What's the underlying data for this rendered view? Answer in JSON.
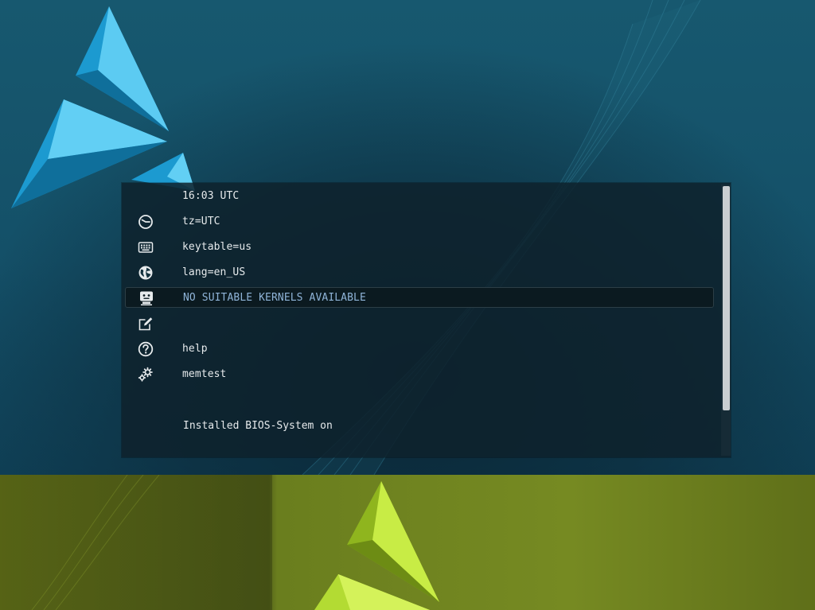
{
  "menu": {
    "items": [
      {
        "icon": "none",
        "label": "16:03 UTC",
        "selected": false
      },
      {
        "icon": "clock-icon",
        "label": "tz=UTC",
        "selected": false
      },
      {
        "icon": "keyboard-icon",
        "label": "keytable=us",
        "selected": false
      },
      {
        "icon": "globe-icon",
        "label": "lang=en_US",
        "selected": false
      },
      {
        "icon": "monitor-face-icon",
        "label": "NO SUITABLE KERNELS AVAILABLE",
        "selected": true
      },
      {
        "icon": "edit-icon",
        "label": "",
        "selected": false
      },
      {
        "icon": "help-icon",
        "label": "help",
        "selected": false
      },
      {
        "icon": "gears-icon",
        "label": "memtest",
        "selected": false
      }
    ],
    "footer": "Installed BIOS-System on"
  },
  "colors": {
    "background_top": "#145068",
    "background_bottom": "#768a22",
    "panel": "#0e222c",
    "text": "#e6eaec",
    "selected_text": "#8fb4d8",
    "logo_blue": "#2ab0e4",
    "logo_green": "#a7d12a"
  }
}
